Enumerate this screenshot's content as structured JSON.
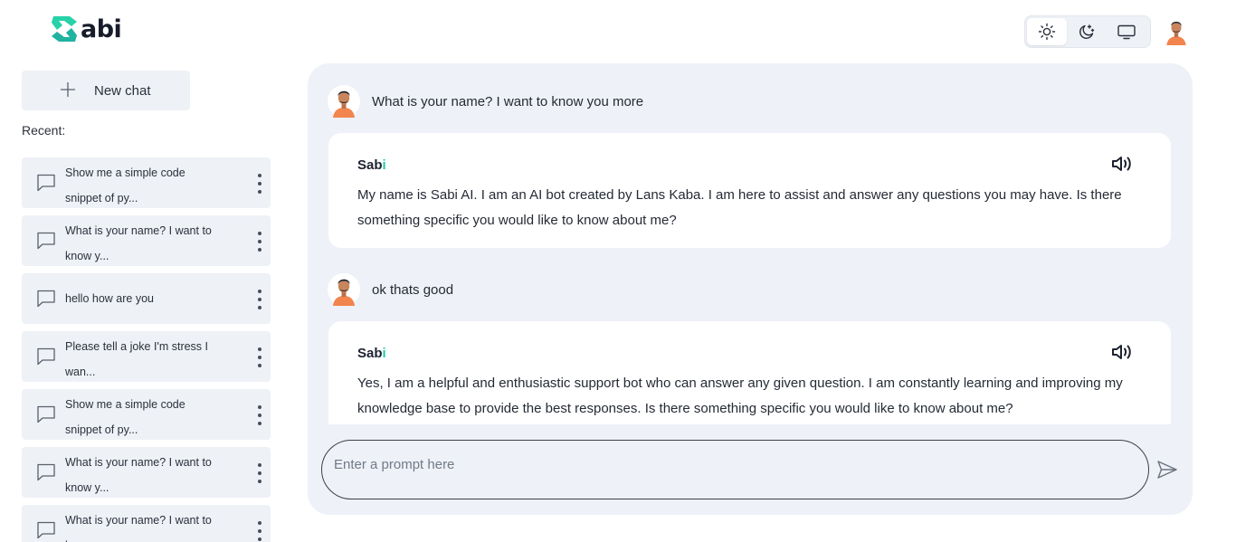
{
  "app": {
    "brand": "abi"
  },
  "header": {
    "theme_options": [
      {
        "name": "light",
        "icon": "sun-icon",
        "active": true
      },
      {
        "name": "dark",
        "icon": "moon-stars-icon",
        "active": false
      },
      {
        "name": "system",
        "icon": "monitor-icon",
        "active": false
      }
    ]
  },
  "sidebar": {
    "new_chat_label": "New chat",
    "recent_label": "Recent:",
    "items": [
      {
        "line1": "Show me a simple code",
        "line2": "snippet of py..."
      },
      {
        "line1": "What is your name? I want to",
        "line2": "know y..."
      },
      {
        "line1": "hello how are you",
        "line2": ""
      },
      {
        "line1": "Please tell a joke I'm stress I",
        "line2": "wan..."
      },
      {
        "line1": "Show me a simple code",
        "line2": "snippet of py..."
      },
      {
        "line1": "What is your name? I want to",
        "line2": "know y..."
      },
      {
        "line1": "What is your name? I want to",
        "line2": "know y..."
      }
    ]
  },
  "chat": {
    "messages": [
      {
        "role": "user",
        "text": "What is your name? I want to know you more"
      },
      {
        "role": "bot",
        "name_main": "Sab",
        "name_accent": "i",
        "text": "My name is Sabi AI. I am an AI bot created by Lans Kaba. I am here to assist and answer any questions you may have. Is there something specific you would like to know about me?"
      },
      {
        "role": "user",
        "text": "ok thats good"
      },
      {
        "role": "bot",
        "name_main": "Sab",
        "name_accent": "i",
        "text": "Yes, I am a helpful and enthusiastic support bot who can answer any given question. I am constantly learning and improving my knowledge base to provide the best responses. Is there something specific you would like to know about me?"
      }
    ],
    "input_placeholder": "Enter a prompt here",
    "input_value": ""
  },
  "colors": {
    "accent": "#21c9a8",
    "panel": "#eef1f7",
    "text": "#252a35"
  }
}
